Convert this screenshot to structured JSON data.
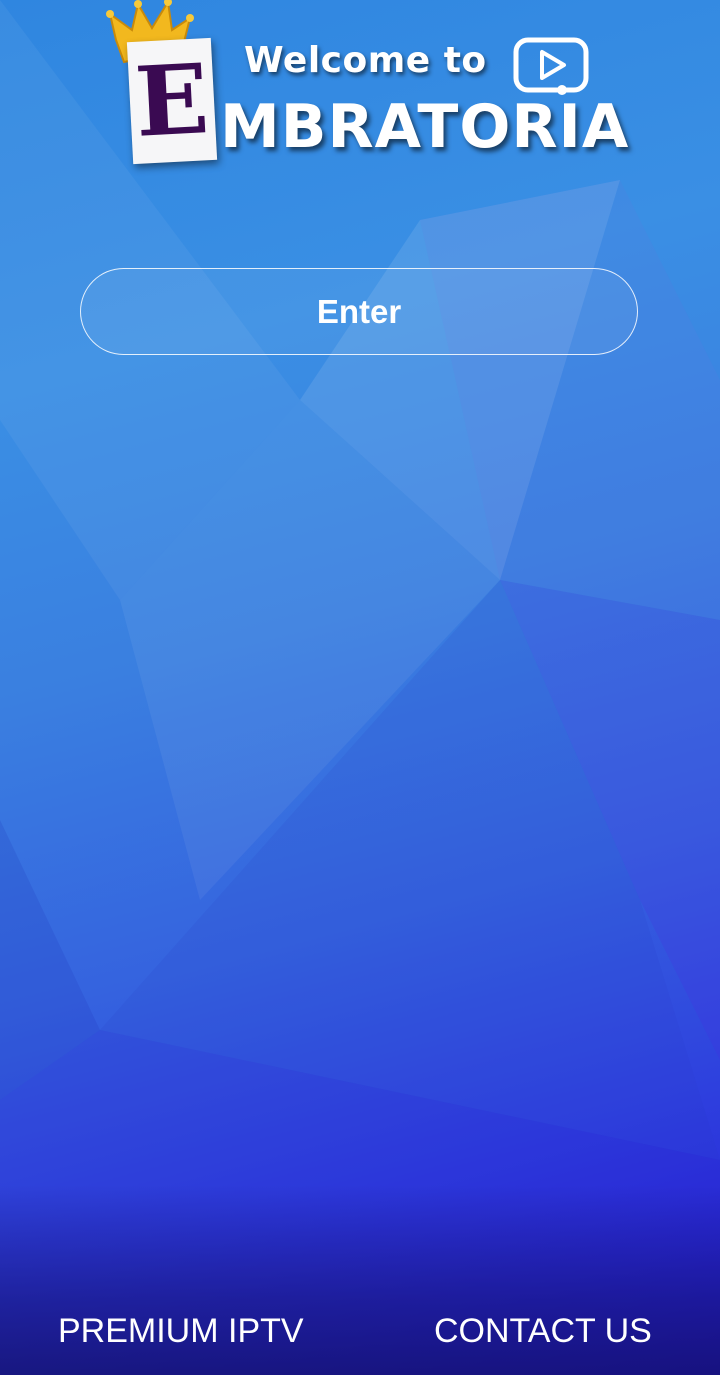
{
  "logo": {
    "welcome_text": "Welcome to",
    "e_letter": "E",
    "brand_text": "MBRATORIA",
    "icons": [
      "crown-icon",
      "play-icon"
    ]
  },
  "main": {
    "enter_label": "Enter"
  },
  "footer": {
    "premium_label": "PREMIUM IPTV",
    "contact_label": "CONTACT US"
  },
  "colors": {
    "background_top": "#2f86e0",
    "background_bottom": "#2418d4",
    "text": "#ffffff",
    "e_letter": "#3a0a52",
    "crown": "#f2b81e"
  }
}
